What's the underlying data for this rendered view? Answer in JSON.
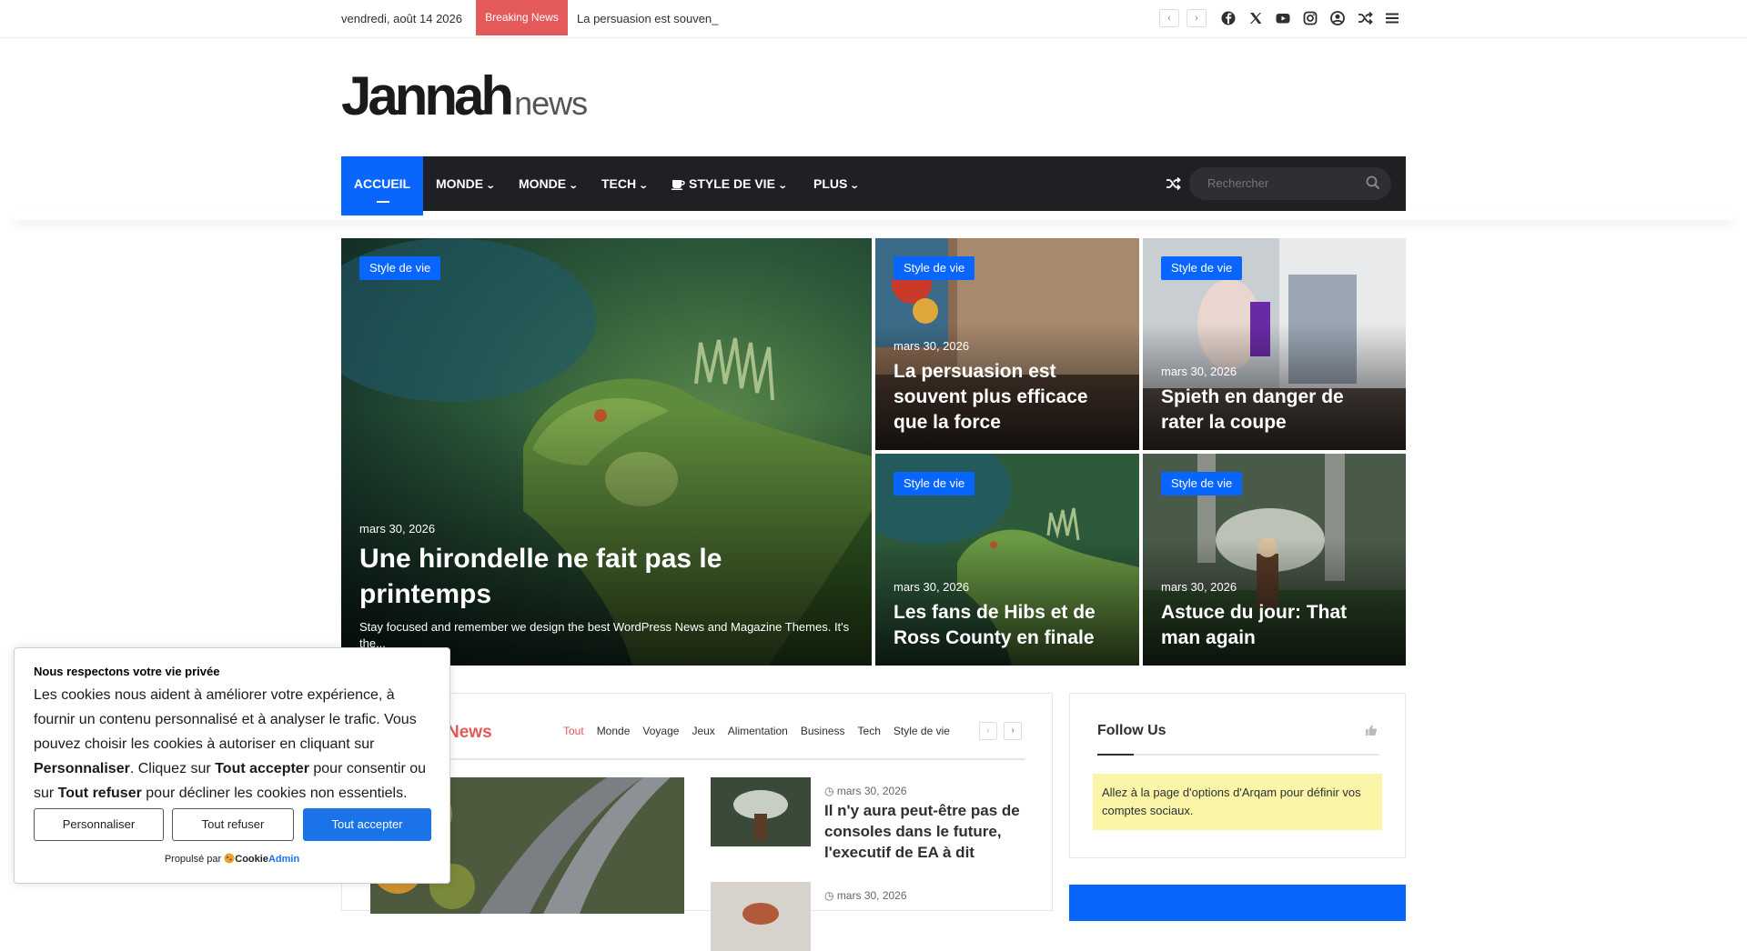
{
  "topbar": {
    "date": "vendredi, août 14 2026",
    "breaking_label": "Breaking News",
    "ticker_text": "La persuasion est souven_",
    "prev_arrow": "‹",
    "next_arrow": "›",
    "social_icons": [
      "facebook-icon",
      "x-icon",
      "youtube-icon",
      "instagram-icon",
      "user-icon",
      "random-icon",
      "menu-icon"
    ]
  },
  "logo": {
    "main": "Jannah",
    "sub": "news"
  },
  "nav": {
    "items": [
      "ACCUEIL",
      "MONDE",
      "MONDE",
      "TECH",
      "STYLE DE VIE",
      "PLUS"
    ],
    "search_placeholder": "Rechercher"
  },
  "hero": {
    "main": {
      "category": "Style de vie",
      "date": "mars 30, 2026",
      "title": "Une hirondelle ne fait pas le printemps",
      "excerpt": "Stay focused and remember we design the best WordPress News and Magazine Themes. It's the..."
    },
    "cards": [
      {
        "category": "Style de vie",
        "date": "mars 30, 2026",
        "title": "La persuasion est souvent plus efficace que la force"
      },
      {
        "category": "Style de vie",
        "date": "mars 30, 2026",
        "title": "Spieth en danger de rater la coupe"
      },
      {
        "category": "Style de vie",
        "date": "mars 30, 2026",
        "title": "Les fans de Hibs et de Ross County en finale"
      },
      {
        "category": "Style de vie",
        "date": "mars 30, 2026",
        "title": "Astuce du jour: That man again"
      }
    ]
  },
  "news_block": {
    "title": "News",
    "tabs": [
      "Tout",
      "Monde",
      "Voyage",
      "Jeux",
      "Alimentation",
      "Business",
      "Tech",
      "Style de vie"
    ],
    "items": [
      {
        "date": "mars 30, 2026",
        "title": "Il n'y aura peut-être pas de consoles dans le future, l'executif de EA à dit"
      },
      {
        "date": "mars 30, 2026",
        "title": ""
      }
    ]
  },
  "follow": {
    "title": "Follow Us",
    "notice": "Allez à la page d'options d'Arqam pour définir vos comptes sociaux."
  },
  "cookie": {
    "title": "Nous respectons votre vie privée",
    "text_1": "Les cookies nous aident à améliorer votre expérience, à fournir un contenu personnalisé et à analyser le trafic. Vous pouvez choisir les cookies à autoriser en cliquant sur ",
    "bold_1": "Personnaliser",
    "text_2": ". Cliquez sur ",
    "bold_2": "Tout accepter",
    "text_3": " pour consentir ou sur ",
    "bold_3": "Tout refuser",
    "text_4": " pour décliner les cookies non essentiels.",
    "btn_customize": "Personnaliser",
    "btn_reject": "Tout refuser",
    "btn_accept": "Tout accepter",
    "powered_prefix": "Propulsé par",
    "brand_a": "Cookie",
    "brand_b": "Admin"
  },
  "colors": {
    "accent": "#0866ff",
    "breaking": "#e45959",
    "nav_bg": "#1f2024",
    "notice_bg": "#fbf6a7"
  }
}
